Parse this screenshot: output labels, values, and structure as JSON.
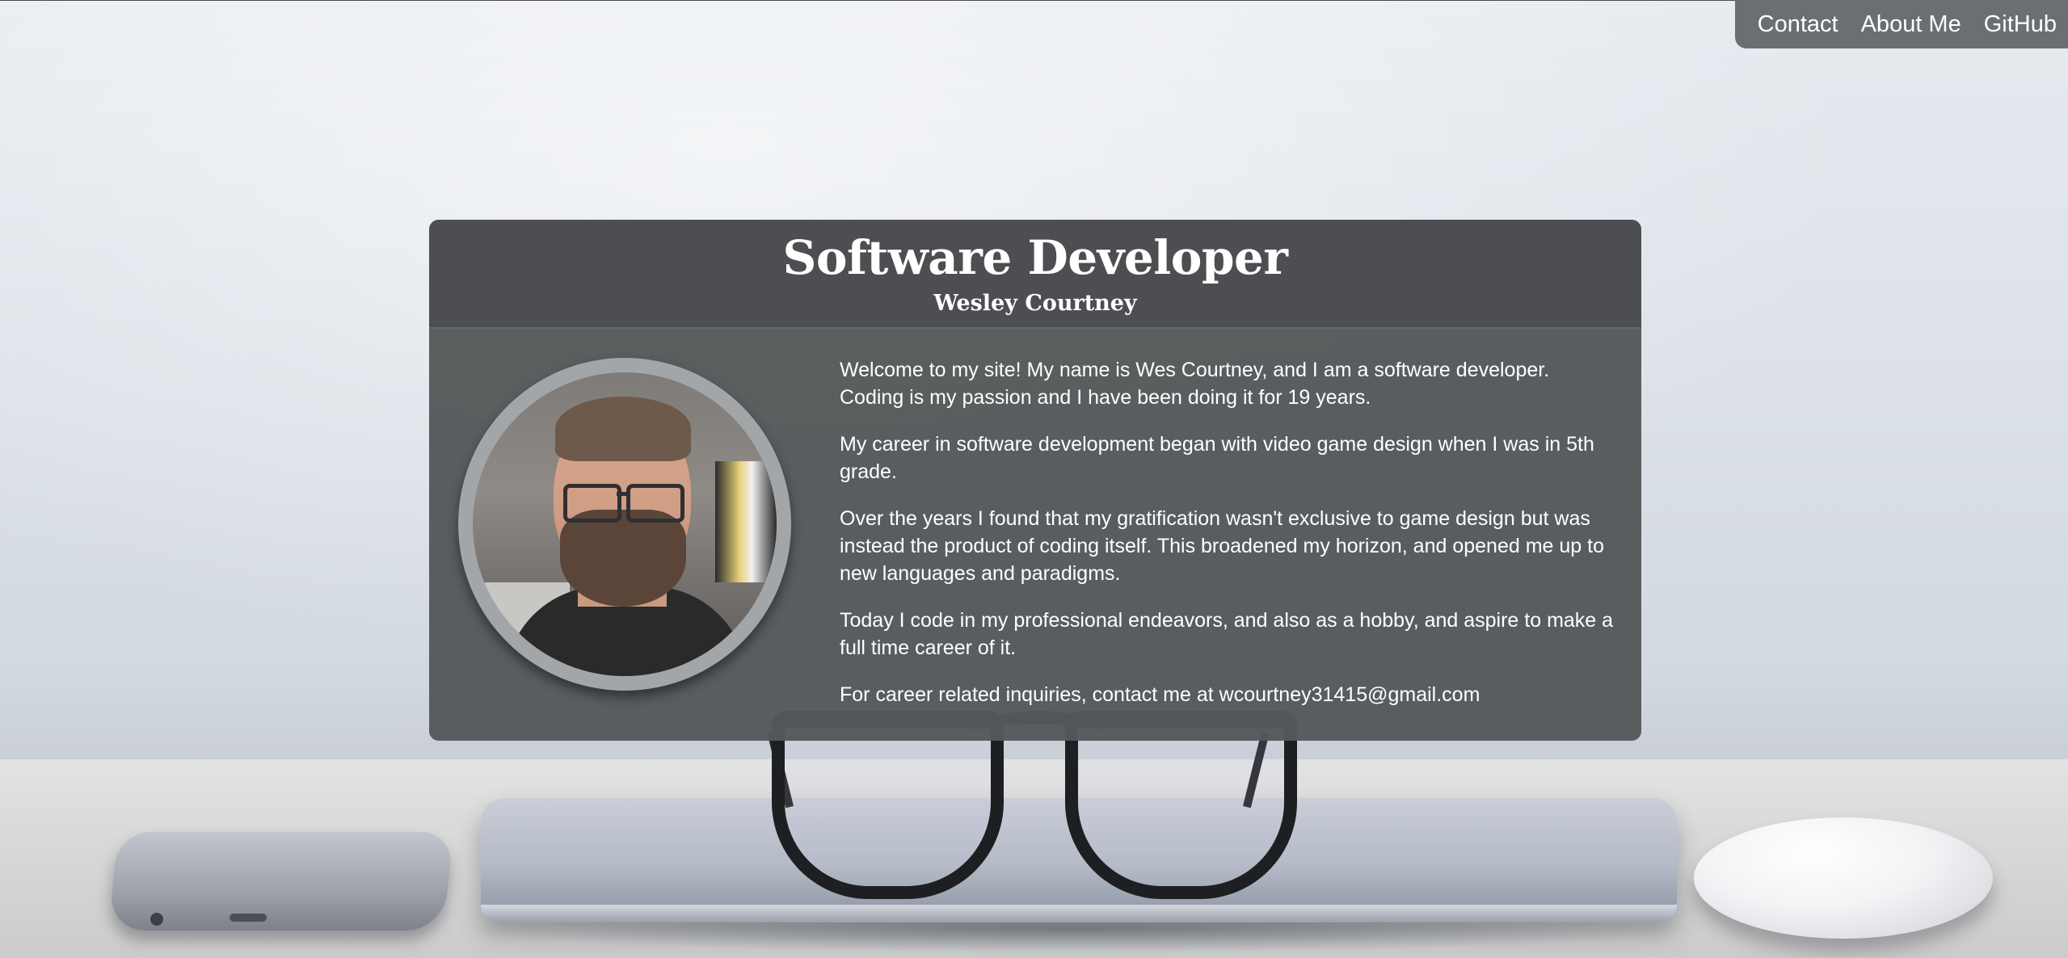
{
  "nav": {
    "items": [
      {
        "label": "Contact"
      },
      {
        "label": "About Me"
      },
      {
        "label": "GitHub"
      }
    ]
  },
  "hero": {
    "title": "Software Developer",
    "subtitle": "Wesley Courtney"
  },
  "about": {
    "paragraphs": [
      "Welcome to my site! My name is Wes Courtney, and I am a software developer. Coding is my passion and I have been doing it for 19 years.",
      "My career in software development began with video game design when I was in 5th grade.",
      "Over the years I found that my gratification wasn't exclusive to game design but was instead the product of coding itself. This broadened my horizon, and opened me up to new languages and paradigms.",
      "Today I code in my professional endeavors, and also as a hobby, and aspire to make a full time career of it."
    ],
    "contact_prefix": "For career related inquiries, contact me at ",
    "contact_email": "wcourtney31415@gmail.com"
  },
  "colors": {
    "nav_background": "#6b6e73",
    "card_background": "#505255",
    "text": "#ffffff"
  }
}
